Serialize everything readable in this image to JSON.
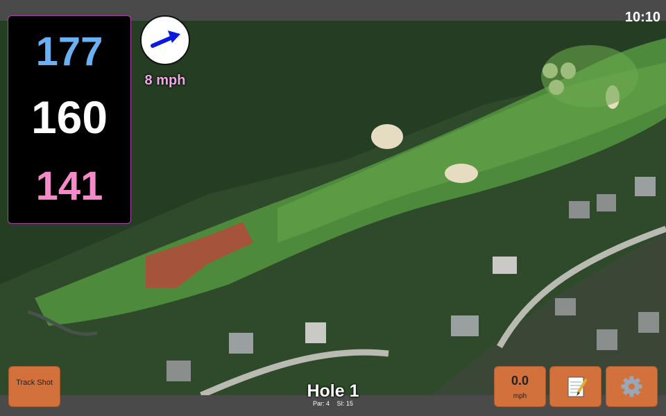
{
  "status": {
    "time": "10:10"
  },
  "distances": {
    "back": "177",
    "middle": "160",
    "front": "141"
  },
  "wind": {
    "speed": "8 mph",
    "icon": "arrow-right-icon"
  },
  "buttons": {
    "track_shot": "Track Shot",
    "speed_value": "0.0",
    "speed_unit": "mph",
    "notes_icon": "notepad-icon",
    "settings_icon": "gear-icon"
  },
  "hole": {
    "title": "Hole 1",
    "par": "Par: 4",
    "si": "SI: 15"
  },
  "colors": {
    "back_distance": "#6bb0f2",
    "middle_distance": "#ffffff",
    "front_distance": "#f58ac8",
    "button": "#d2713c",
    "wind_text": "#f0a8e8"
  }
}
